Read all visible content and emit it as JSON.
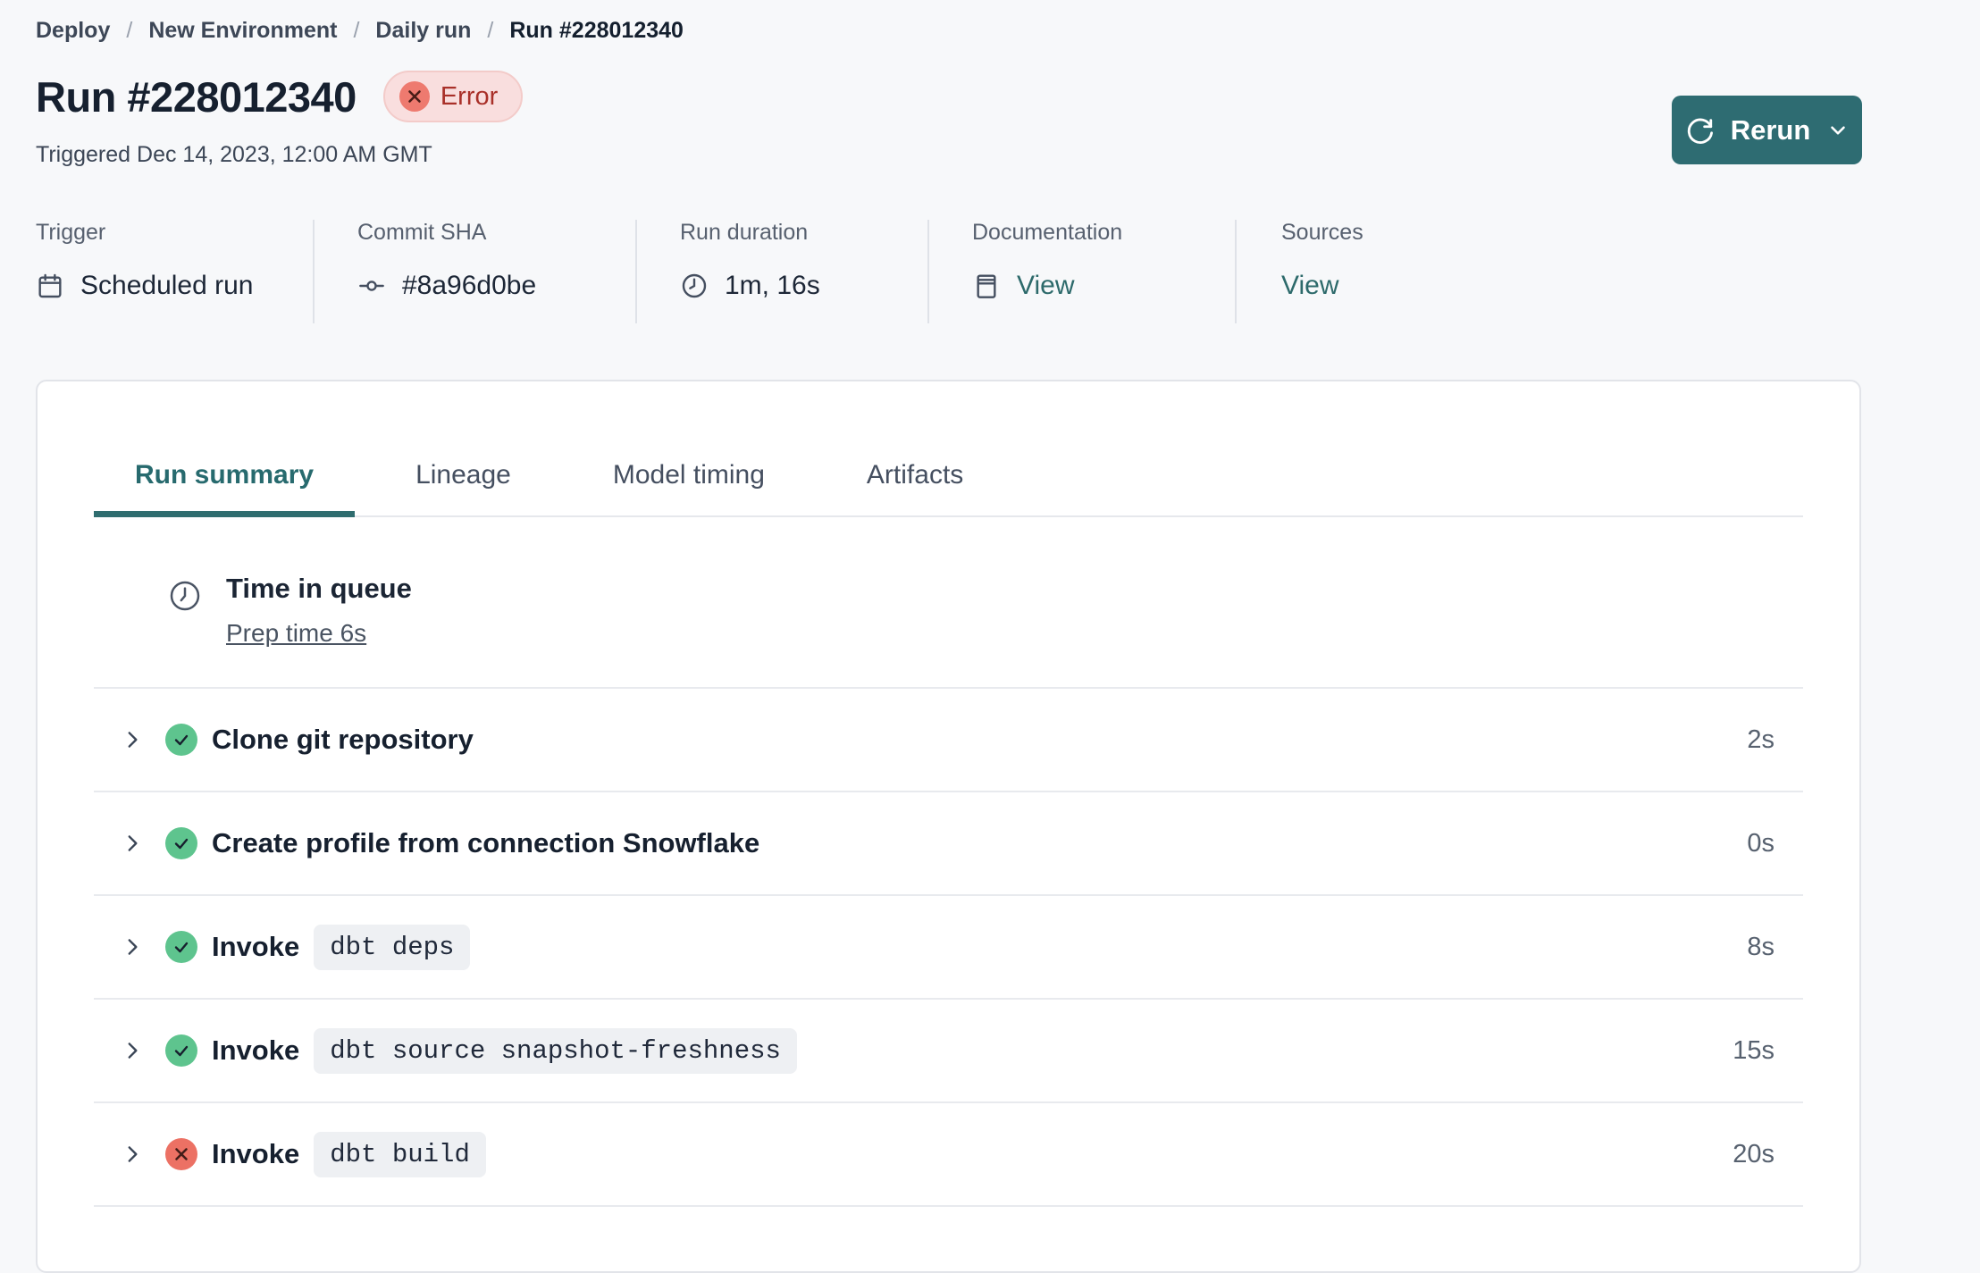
{
  "breadcrumb": {
    "separator": "/",
    "items": [
      {
        "label": "Deploy"
      },
      {
        "label": "New Environment"
      },
      {
        "label": "Daily run"
      },
      {
        "label": "Run #228012340"
      }
    ]
  },
  "header": {
    "title": "Run #228012340",
    "badge": {
      "label": "Error"
    },
    "triggered": "Triggered Dec 14, 2023, 12:00 AM GMT",
    "rerun": {
      "label": "Rerun"
    }
  },
  "meta": [
    {
      "label": "Trigger",
      "value": "Scheduled run",
      "icon": "calendar-icon"
    },
    {
      "label": "Commit SHA",
      "value": "#8a96d0be",
      "icon": "git-commit-icon"
    },
    {
      "label": "Run duration",
      "value": "1m, 16s",
      "icon": "clock-icon"
    },
    {
      "label": "Documentation",
      "value": "View",
      "icon": "book-icon"
    },
    {
      "label": "Sources",
      "value": "View"
    }
  ],
  "tabs": [
    {
      "label": "Run summary",
      "active": true
    },
    {
      "label": "Lineage",
      "active": false
    },
    {
      "label": "Model timing",
      "active": false
    },
    {
      "label": "Artifacts",
      "active": false
    }
  ],
  "queue": {
    "title": "Time in queue",
    "link": "Prep time 6s",
    "icon": "clock-icon"
  },
  "steps": [
    {
      "status": "success",
      "label": "Clone git repository",
      "duration": "2s"
    },
    {
      "status": "success",
      "label": "Create profile from connection Snowflake",
      "duration": "0s"
    },
    {
      "status": "success",
      "label": "Invoke",
      "code": "dbt deps",
      "duration": "8s"
    },
    {
      "status": "success",
      "label": "Invoke",
      "code": "dbt source snapshot-freshness",
      "duration": "15s"
    },
    {
      "status": "error",
      "label": "Invoke",
      "code": "dbt build",
      "duration": "20s"
    }
  ],
  "colors": {
    "accent_teal": "#2e6c72",
    "link_teal": "#2d6a6b",
    "active_tab_teal": "#276a6e",
    "success_green": "#5ec48e",
    "error_red": "#ec7164",
    "badge_bg": "#f9dede",
    "badge_border": "#f3cbc9",
    "badge_text": "#a93029",
    "page_bg": "#f7f8fa",
    "card_border": "#e2e4e9",
    "divider": "#e8eaee"
  }
}
